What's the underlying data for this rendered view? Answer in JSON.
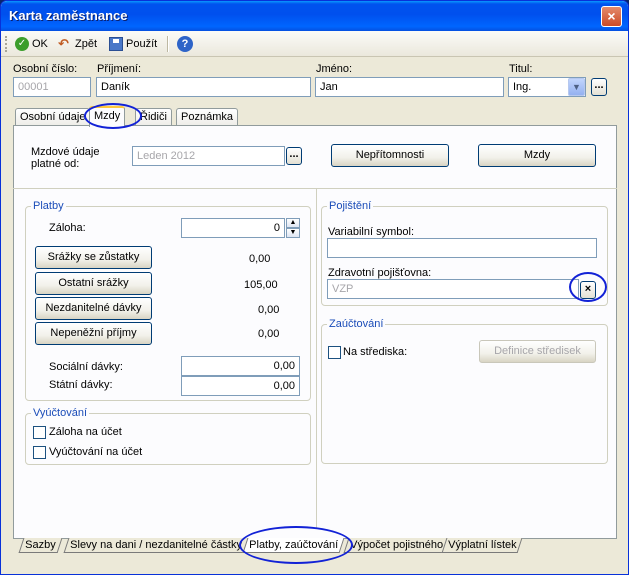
{
  "window": {
    "title": "Karta zaměstnance",
    "close": "×"
  },
  "toolbar": {
    "ok": "OK",
    "back": "Zpět",
    "apply": "Použít"
  },
  "header": {
    "osobni_cislo_label": "Osobní číslo:",
    "osobni_cislo_value": "00001",
    "prijmeni_label": "Příjmení:",
    "prijmeni_value": "Daník",
    "jmeno_label": "Jméno:",
    "jmeno_value": "Jan",
    "titul_label": "Titul:",
    "titul_value": "Ing."
  },
  "tabs": [
    "Osobní údaje",
    "Mzdy",
    "Řidiči",
    "Poznámka"
  ],
  "mzdy": {
    "platne_od_label_1": "Mzdové údaje",
    "platne_od_label_2": "platné od:",
    "platne_od_value": "Leden 2012",
    "nepritomnosti": "Nepřítomnosti",
    "mzdy_button": "Mzdy"
  },
  "platby": {
    "title": "Platby",
    "zaloha_label": "Záloha:",
    "zaloha_value": "0",
    "srazky_zustatky": "Srážky se zůstatky",
    "srazky_zustatky_value": "0,00",
    "ostatni_srazky": "Ostatní srážky",
    "ostatni_srazky_value": "105,00",
    "nezdanitelne": "Nezdanitelné dávky",
    "nezdanitelne_value": "0,00",
    "nepenezni": "Nepeněžní příjmy",
    "nepenezni_value": "0,00",
    "socialni_label": "Sociální dávky:",
    "socialni_value": "0,00",
    "statni_label": "Státní dávky:",
    "statni_value": "0,00"
  },
  "vyuctovani": {
    "title": "Vyúčtování",
    "zaloha_na_ucet": "Záloha na účet",
    "vyuctovani_na_ucet": "Vyúčtování na účet"
  },
  "pojisteni": {
    "title": "Pojištění",
    "variabilni_label": "Variabilní symbol:",
    "variabilni_value": "",
    "zdravotni_label": "Zdravotní pojišťovna:",
    "zdravotni_value": "VZP"
  },
  "zauctovani": {
    "title": "Zaúčtování",
    "na_strediska": "Na střediska:",
    "definice": "Definice středisek"
  },
  "bottom_tabs": [
    "Sazby",
    "Slevy na dani / nezdanitelné částky",
    "Platby, zaúčtování",
    "Výpočet pojistného",
    "Výplatní lístek"
  ]
}
